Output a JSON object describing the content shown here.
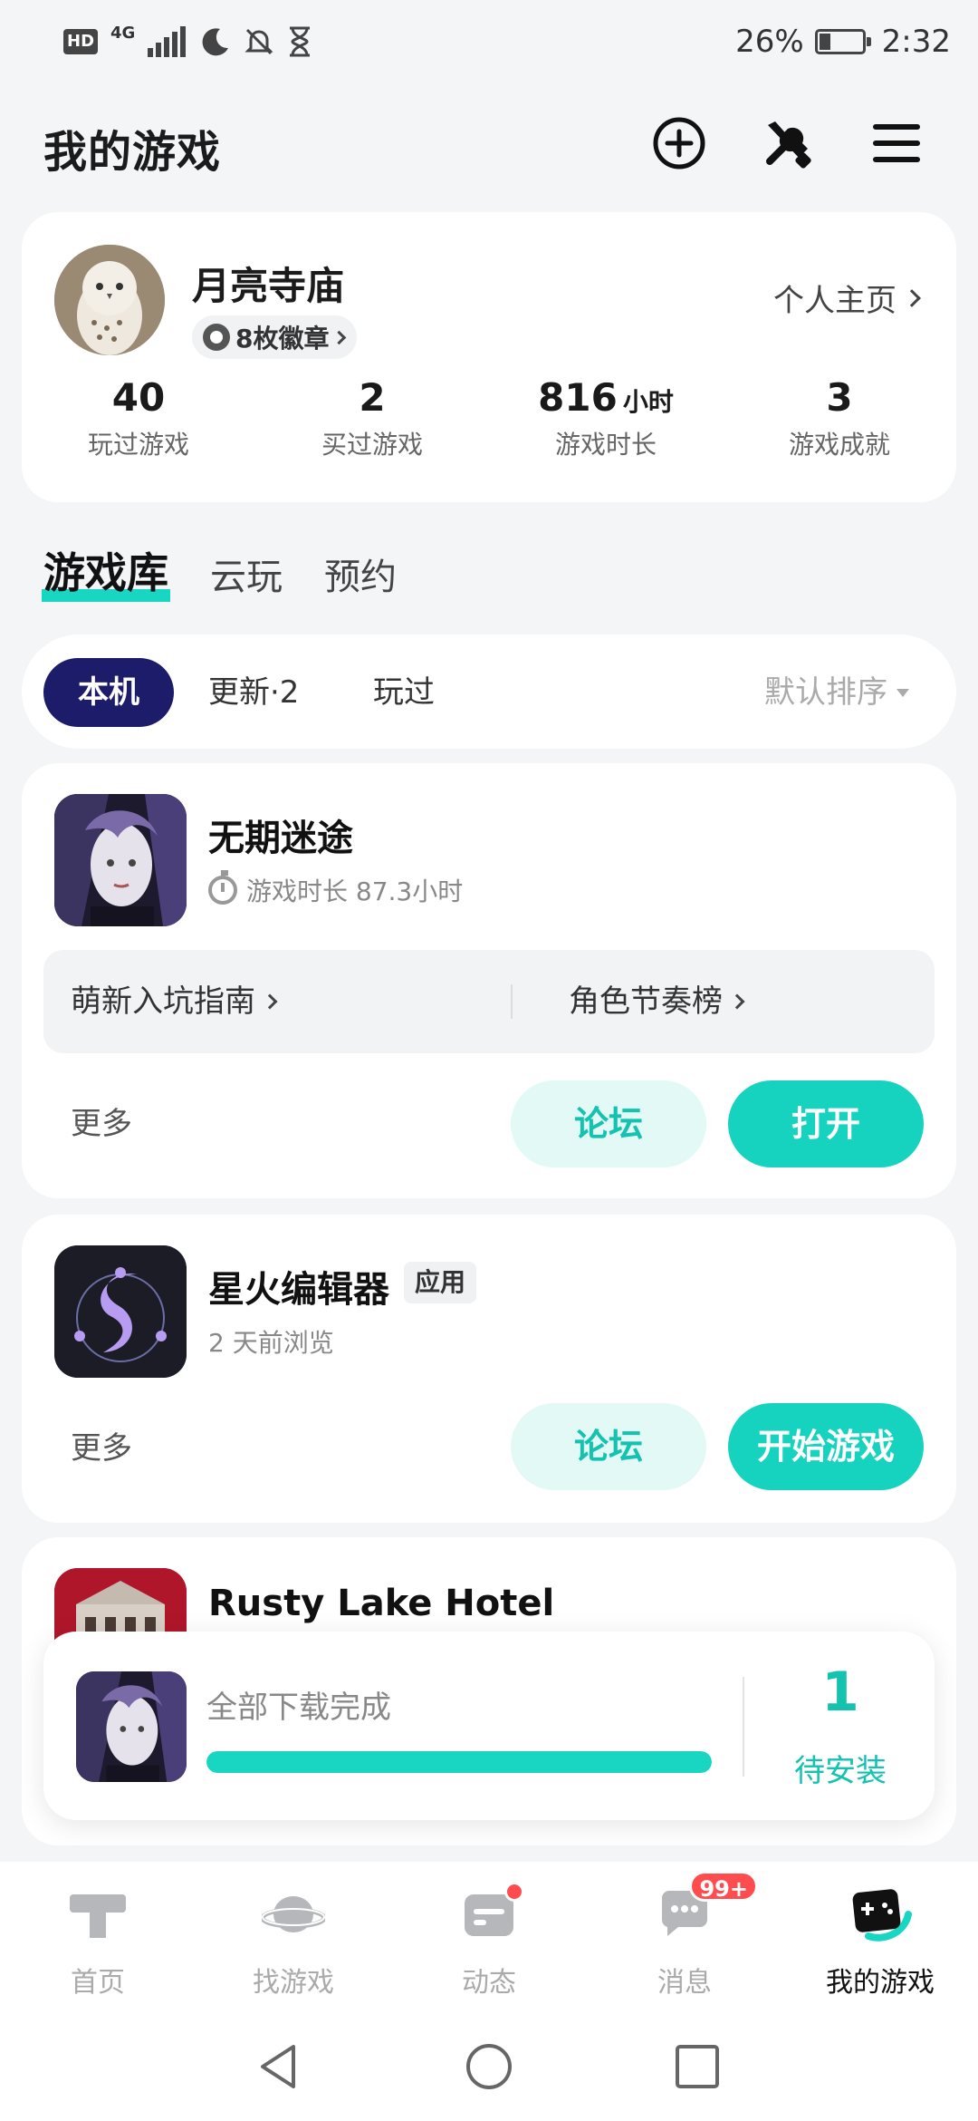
{
  "status_bar": {
    "hd": "HD",
    "network": "4G",
    "battery_pct": "26%",
    "time": "2:32"
  },
  "header": {
    "title": "我的游戏",
    "icons": [
      "add-circle-icon",
      "tools-icon",
      "menu-icon"
    ]
  },
  "profile": {
    "name": "月亮寺庙",
    "badges": "8枚徽章",
    "homepage_link": "个人主页",
    "stats": [
      {
        "value": "40",
        "unit": "",
        "label": "玩过游戏"
      },
      {
        "value": "2",
        "unit": "",
        "label": "买过游戏"
      },
      {
        "value": "816",
        "unit": "小时",
        "label": "游戏时长"
      },
      {
        "value": "3",
        "unit": "",
        "label": "游戏成就"
      }
    ]
  },
  "tabs": [
    {
      "label": "游戏库",
      "active": true
    },
    {
      "label": "云玩",
      "active": false
    },
    {
      "label": "预约",
      "active": false
    }
  ],
  "filters": {
    "local": "本机",
    "update": "更新·2",
    "played": "玩过",
    "sort": "默认排序"
  },
  "games": [
    {
      "title": "无期迷途",
      "meta": "游戏时长 87.3小时",
      "guide_left": "萌新入坑指南",
      "guide_right": "角色节奏榜",
      "more": "更多",
      "forum": "论坛",
      "primary": "打开"
    },
    {
      "title": "星火编辑器",
      "tag": "应用",
      "meta": "2 天前浏览",
      "more": "更多",
      "forum": "论坛",
      "primary": "开始游戏"
    },
    {
      "title": "Rusty Lake Hotel"
    }
  ],
  "download": {
    "text": "全部下载完成",
    "progress": 1.0,
    "count": "1",
    "label": "待安装"
  },
  "bottom_nav": [
    {
      "label": "首页",
      "icon": "home-icon"
    },
    {
      "label": "找游戏",
      "icon": "planet-icon"
    },
    {
      "label": "动态",
      "icon": "feed-icon"
    },
    {
      "label": "消息",
      "icon": "chat-icon",
      "badge": "99+"
    },
    {
      "label": "我的游戏",
      "icon": "gamepad-icon",
      "active": true
    }
  ],
  "colors": {
    "accent": "#16d3bf",
    "chip_active": "#1c1c6a",
    "badge_red": "#ff4d4f"
  }
}
